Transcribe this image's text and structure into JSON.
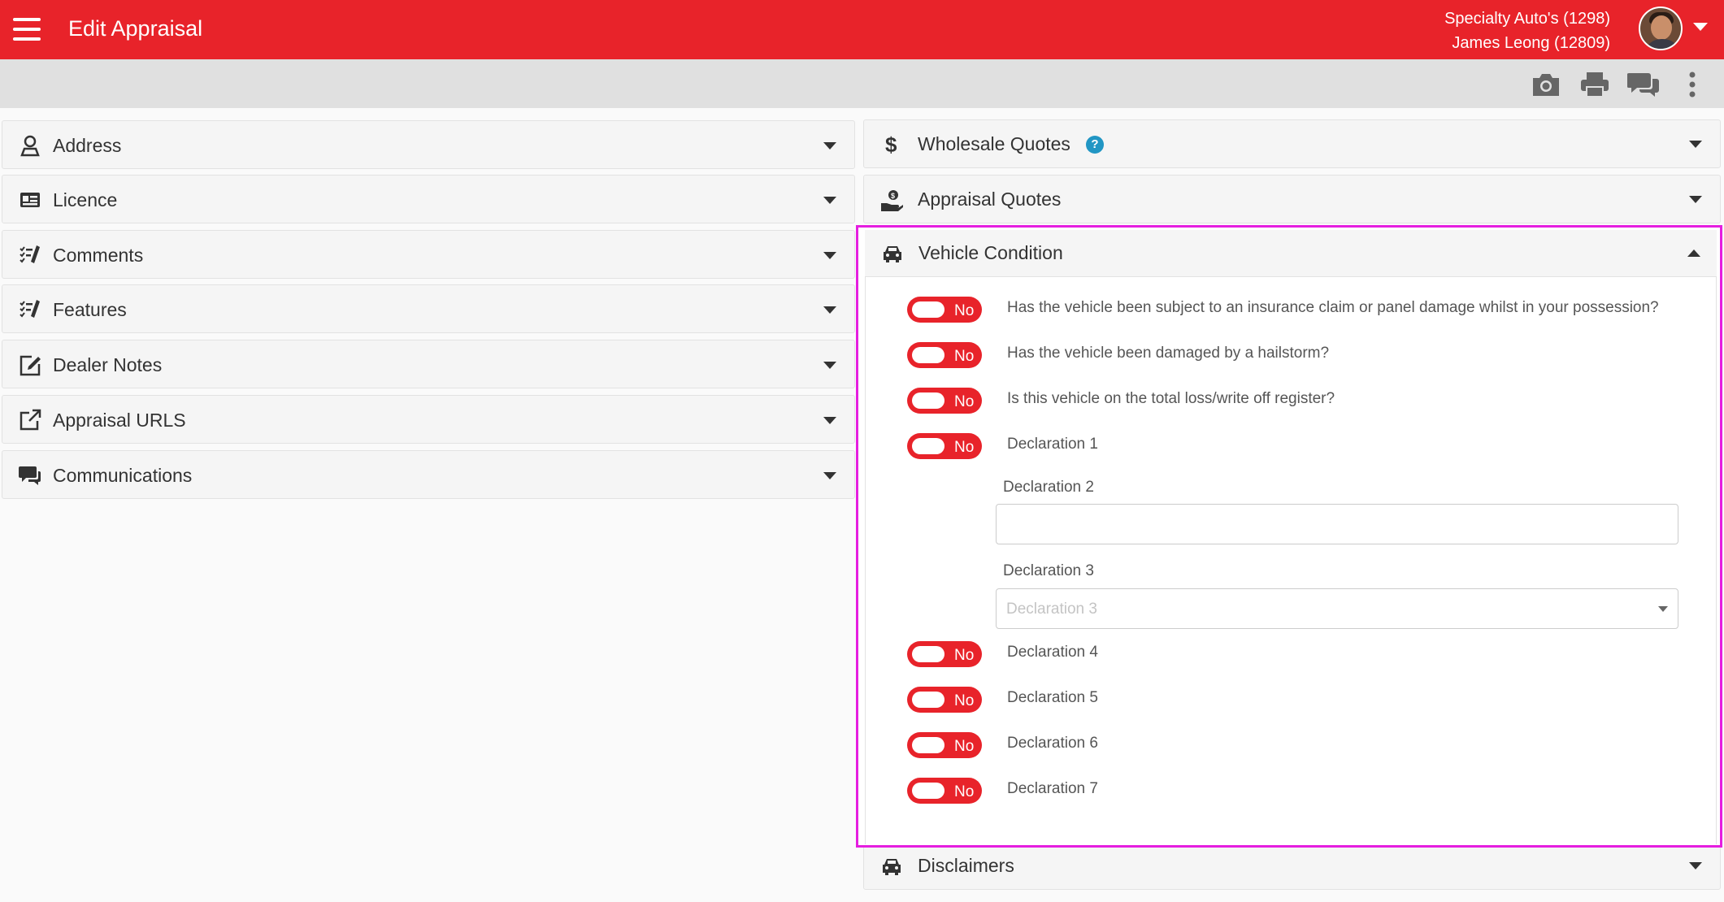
{
  "app": {
    "title": "Edit Appraisal",
    "dealer": "Specialty Auto's (1298)",
    "user": "James Leong (12809)",
    "accent_color": "#e8232a"
  },
  "toolbar": {
    "icons": [
      "camera-icon",
      "print-icon",
      "comments-icon",
      "more-vert-icon"
    ]
  },
  "left_sections": [
    {
      "label": "Address",
      "icon": "map-pin-person-icon"
    },
    {
      "label": "Licence",
      "icon": "id-card-icon"
    },
    {
      "label": "Comments",
      "icon": "checklist-pencil-icon"
    },
    {
      "label": "Features",
      "icon": "checklist-pencil-icon"
    },
    {
      "label": "Dealer Notes",
      "icon": "edit-note-icon"
    },
    {
      "label": "Appraisal URLS",
      "icon": "external-link-icon"
    },
    {
      "label": "Communications",
      "icon": "chat-bubbles-icon"
    }
  ],
  "right_sections": {
    "wholesale_quotes": {
      "label": "Wholesale Quotes",
      "help": "?"
    },
    "appraisal_quotes": {
      "label": "Appraisal Quotes"
    },
    "vehicle_condition": {
      "label": "Vehicle Condition"
    },
    "disclaimers": {
      "label": "Disclaimers"
    }
  },
  "vehicle_condition": {
    "toggle_value": "No",
    "questions": [
      "Has the vehicle been subject to an insurance claim or panel damage whilst in your possession?",
      "Has the vehicle been damaged by a hailstorm?",
      "Is this vehicle on the total loss/write off register?",
      "Declaration 1"
    ],
    "declaration_2_label": "Declaration 2",
    "declaration_2_value": "",
    "declaration_3_label": "Declaration 3",
    "declaration_3_placeholder": "Declaration 3",
    "more_declarations": [
      "Declaration 4",
      "Declaration 5",
      "Declaration 6",
      "Declaration 7"
    ]
  }
}
